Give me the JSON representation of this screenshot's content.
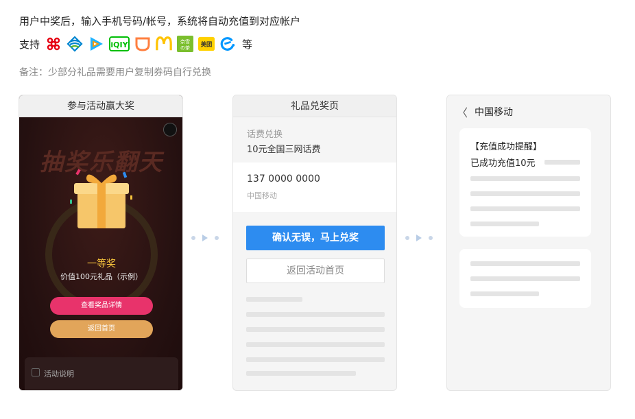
{
  "intro": {
    "line1": "用户中奖后，输入手机号码/帐号，系统将自动充值到对应帐户",
    "support_label": "支持",
    "support_suffix": "等",
    "brands": [
      "china-unicom-icon",
      "china-mobile-icon",
      "tencent-video-icon",
      "iqiyi-icon",
      "didi-icon",
      "mcdonalds-icon",
      "yiyi-tea-icon",
      "meituan-icon",
      "ele-me-icon"
    ],
    "note": "备注：少部分礼品需要用户复制券码自行兑换"
  },
  "phone1": {
    "header": "参与活动赢大奖",
    "banner": "抽奖乐翻天",
    "prize_title": "一等奖",
    "prize_value": "价值100元礼品（示例）",
    "detail_button": "查看奖品详情",
    "back_button": "返回首页",
    "rules_title": "活动说明"
  },
  "phone2": {
    "header": "礼品兑奖页",
    "type_label": "话费兑换",
    "type_value": "10元全国三网话费",
    "phone_number": "137 0000 0000",
    "carrier": "中国移动",
    "confirm_button": "确认无误，马上兑奖",
    "return_button": "返回活动首页"
  },
  "phone3": {
    "back_glyph": "〈",
    "title": "中国移动",
    "msg_title": "【充值成功提醒】",
    "msg_body": "已成功充值10元"
  },
  "colors": {
    "primary": "#2d8cf0",
    "pink": "#e8336b",
    "gold": "#e2a55a",
    "prize": "#f6c33d"
  }
}
